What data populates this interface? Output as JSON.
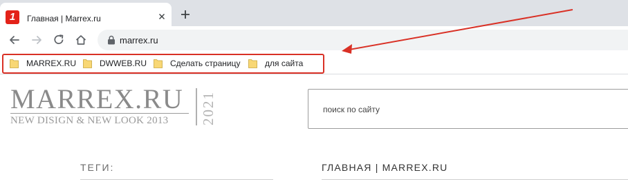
{
  "browser": {
    "tab": {
      "title": "Главная | Marrex.ru",
      "favicon_glyph": "1",
      "favicon_color": "#e32219"
    },
    "address_bar": {
      "url": "marrex.ru"
    },
    "bookmarks": [
      {
        "label": "MARREX.RU"
      },
      {
        "label": "DWWEB.RU"
      },
      {
        "label": "Сделать страницу"
      },
      {
        "label": "для сайта"
      }
    ],
    "highlight_color": "#d93025"
  },
  "page": {
    "logo": {
      "name": "MARREX.RU",
      "tagline": "NEW DISIGN & NEW LOOK 2013",
      "year": "2021"
    },
    "search": {
      "placeholder": "поиск по сайту"
    },
    "tags_label": "ТЕГИ:",
    "heading": "ГЛАВНАЯ | MARREX.RU"
  }
}
